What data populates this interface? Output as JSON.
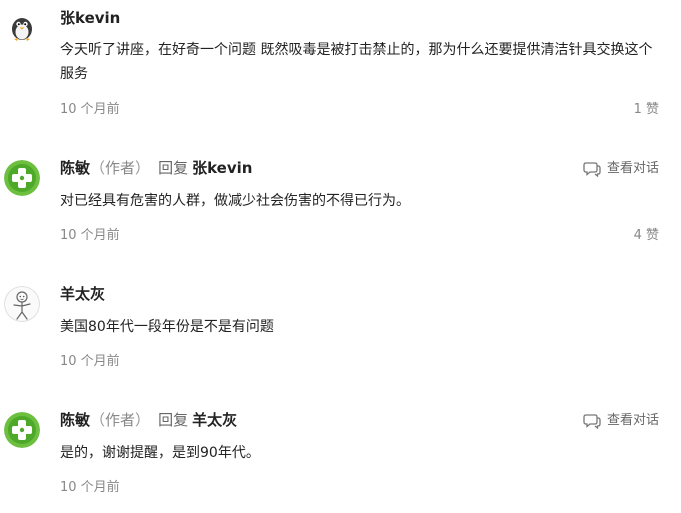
{
  "comments": [
    {
      "author": "张kevin",
      "text": "今天听了讲座，在好奇一个问题 既然吸毒是被打击禁止的，那为什么还要提供清洁针具交换这个服务",
      "time": "10 个月前",
      "likes": "1 赞",
      "avatar_icon": "penguin-avatar-icon"
    },
    {
      "author": "陈敏",
      "role_open": "（",
      "role": "作者",
      "role_close": "）",
      "reply_label": "回复",
      "reply_to": "张kevin",
      "text": "对已经具有危害的人群，做减少社会伤害的不得已行为。",
      "time": "10 个月前",
      "likes": "4 赞",
      "view_conversation": "查看对话",
      "avatar_icon": "green-cross-avatar-icon"
    },
    {
      "author": "羊太灰",
      "text": "美国80年代一段年份是不是有问题",
      "time": "10 个月前",
      "avatar_icon": "sketch-figure-avatar-icon"
    },
    {
      "author": "陈敏",
      "role_open": "（",
      "role": "作者",
      "role_close": "）",
      "reply_label": "回复",
      "reply_to": "羊太灰",
      "text": "是的，谢谢提醒，是到90年代。",
      "time": "10 个月前",
      "view_conversation": "查看对话",
      "avatar_icon": "green-cross-avatar-icon"
    }
  ],
  "colors": {
    "author_avatar_green": "#4caf50",
    "muted_text": "#888888"
  }
}
